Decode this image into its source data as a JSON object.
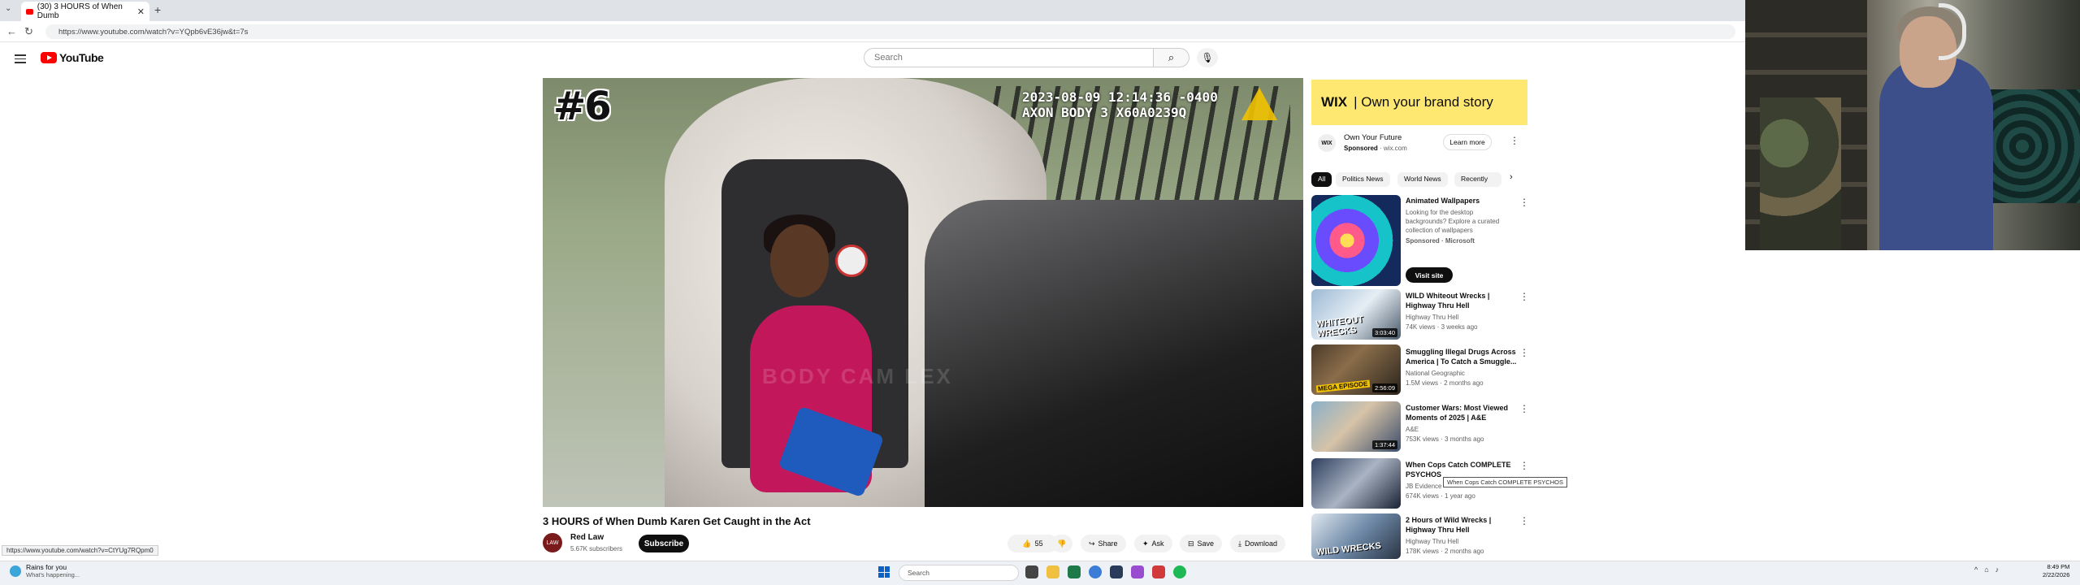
{
  "browser": {
    "tab_title": "(30) 3 HOURS of When Dumb",
    "url": "https://www.youtube.com/watch?v=YQpb6vE36jw&t=7s",
    "status_link": "https://www.youtube.com/watch?v=CtYUg7RQpm0"
  },
  "youtube": {
    "logo_text": "YouTube",
    "search_placeholder": "Search"
  },
  "video": {
    "badge": "#6",
    "timestamp_line1": "2023-08-09 12:14:36 -0400",
    "timestamp_line2": "AXON BODY 3 X60A0239Q",
    "watermark": "BODY CAM LEX",
    "title": "3 HOURS of When Dumb Karen Get Caught in the Act",
    "channel_name": "Red Law",
    "channel_avatar_text": "LAW",
    "subscribers": "5.67K subscribers",
    "subscribe_label": "Subscribe",
    "like_count": "55",
    "share_label": "Share",
    "ask_label": "Ask",
    "save_label": "Save",
    "download_label": "Download"
  },
  "ad": {
    "banner_brand": "WIX",
    "banner_text": "| Own your brand story",
    "icon_text": "WIX",
    "title": "Own Your Future",
    "sponsored": "Sponsored",
    "domain": "· wix.com",
    "learn_more": "Learn more"
  },
  "chips": [
    "All",
    "Politics News",
    "World News",
    "Recently"
  ],
  "recommendations": [
    {
      "title_l1": "Animated Wallpapers",
      "channel": "Looking for the desktop backgrounds? Explore a curated",
      "meta": "collection of wallpapers",
      "extra": "Sponsored · Microsoft",
      "button": "Visit site",
      "duration": ""
    },
    {
      "title_l1": "WILD Whiteout Wrecks |",
      "title_l2": "Highway Thru Hell",
      "channel": "Highway Thru Hell",
      "meta": "74K views · 3 weeks ago",
      "duration": "3:03:40",
      "thumb_text": "WHITEOUT WRECKS"
    },
    {
      "title_l1": "Smuggling Illegal Drugs Across",
      "title_l2": "America | To Catch a Smuggle...",
      "channel": "National Geographic",
      "meta": "1.5M views · 2 months ago",
      "duration": "2:56:09",
      "thumb_text": "MEGA EPISODE"
    },
    {
      "title_l1": "Customer Wars: Most Viewed",
      "title_l2": "Moments of 2025 | A&E",
      "channel": "A&E",
      "meta": "753K views · 3 months ago",
      "duration": "1:37:44",
      "thumb_text": ""
    },
    {
      "title_l1": "When Cops Catch COMPLETE",
      "title_l2": "PSYCHOS",
      "channel": "JB Evidence",
      "meta": "674K views · 1 year ago",
      "duration": "",
      "thumb_text": ""
    },
    {
      "title_l1": "2 Hours of Wild Wrecks |",
      "title_l2": "Highway Thru Hell",
      "channel": "Highway Thru Hell",
      "meta": "178K views · 2 months ago",
      "duration": "",
      "thumb_text": "WILD WRECKS"
    }
  ],
  "tooltip": "When Cops Catch COMPLETE PSYCHOS",
  "taskbar": {
    "weather_line1": "Rains for you",
    "weather_line2": "What's happening...",
    "search_placeholder": "Search",
    "time": "8:49 PM",
    "date": "2/22/2026"
  },
  "colors": {
    "youtube_red": "#ff0000",
    "wix_ad_yellow": "#ffe872",
    "chip_active": "#0f0f0f"
  }
}
